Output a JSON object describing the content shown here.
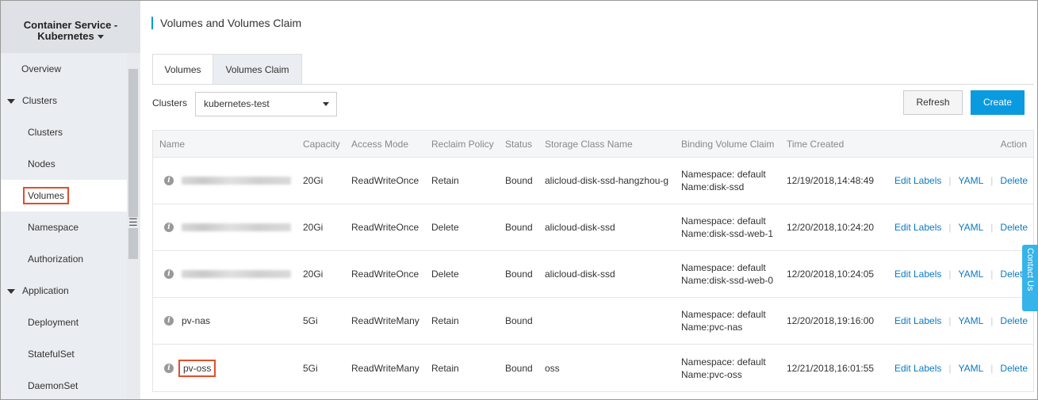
{
  "sidebar": {
    "title_line1": "Container Service -",
    "title_line2": "Kubernetes",
    "items": [
      {
        "label": "Overview"
      },
      {
        "label": "Clusters"
      },
      {
        "label": "Clusters"
      },
      {
        "label": "Nodes"
      },
      {
        "label": "Volumes"
      },
      {
        "label": "Namespace"
      },
      {
        "label": "Authorization"
      },
      {
        "label": "Application"
      },
      {
        "label": "Deployment"
      },
      {
        "label": "StatefulSet"
      },
      {
        "label": "DaemonSet"
      }
    ]
  },
  "page": {
    "title": "Volumes and Volumes Claim"
  },
  "tabs": [
    {
      "label": "Volumes"
    },
    {
      "label": "Volumes Claim"
    }
  ],
  "filter": {
    "clusters_label": "Clusters",
    "cluster_value": "kubernetes-test"
  },
  "buttons": {
    "refresh": "Refresh",
    "create": "Create"
  },
  "table": {
    "headers": {
      "name": "Name",
      "capacity": "Capacity",
      "access_mode": "Access Mode",
      "reclaim_policy": "Reclaim Policy",
      "status": "Status",
      "storage_class": "Storage Class Name",
      "binding": "Binding Volume Claim",
      "time": "Time Created",
      "action": "Action"
    },
    "rows": [
      {
        "name": "",
        "capacity": "20Gi",
        "access_mode": "ReadWriteOnce",
        "reclaim_policy": "Retain",
        "status": "Bound",
        "storage_class": "alicloud-disk-ssd-hangzhou-g",
        "binding_ns": "Namespace: default",
        "binding_name": "Name:disk-ssd",
        "time": "12/19/2018,14:48:49"
      },
      {
        "name": "",
        "capacity": "20Gi",
        "access_mode": "ReadWriteOnce",
        "reclaim_policy": "Delete",
        "status": "Bound",
        "storage_class": "alicloud-disk-ssd",
        "binding_ns": "Namespace: default",
        "binding_name": "Name:disk-ssd-web-1",
        "time": "12/20/2018,10:24:20"
      },
      {
        "name": "",
        "capacity": "20Gi",
        "access_mode": "ReadWriteOnce",
        "reclaim_policy": "Delete",
        "status": "Bound",
        "storage_class": "alicloud-disk-ssd",
        "binding_ns": "Namespace: default",
        "binding_name": "Name:disk-ssd-web-0",
        "time": "12/20/2018,10:24:05"
      },
      {
        "name": "pv-nas",
        "capacity": "5Gi",
        "access_mode": "ReadWriteMany",
        "reclaim_policy": "Retain",
        "status": "Bound",
        "storage_class": "",
        "binding_ns": "Namespace: default",
        "binding_name": "Name:pvc-nas",
        "time": "12/20/2018,19:16:00"
      },
      {
        "name": "pv-oss",
        "capacity": "5Gi",
        "access_mode": "ReadWriteMany",
        "reclaim_policy": "Retain",
        "status": "Bound",
        "storage_class": "oss",
        "binding_ns": "Namespace: default",
        "binding_name": "Name:pvc-oss",
        "time": "12/21/2018,16:01:55"
      }
    ],
    "actions": {
      "edit_labels": "Edit Labels",
      "yaml": "YAML",
      "delete": "Delete",
      "separator": "|"
    }
  },
  "contact": {
    "label": "Contact Us"
  },
  "colors": {
    "primary": "#0a9ae0",
    "link": "#0a7ac0",
    "highlight": "#e34d2b",
    "sidebar_bg": "#eaedf1"
  },
  "icons": {
    "info": "info-icon",
    "dropdown": "caret-down-icon",
    "collapse": "collapse-sidebar-icon"
  }
}
